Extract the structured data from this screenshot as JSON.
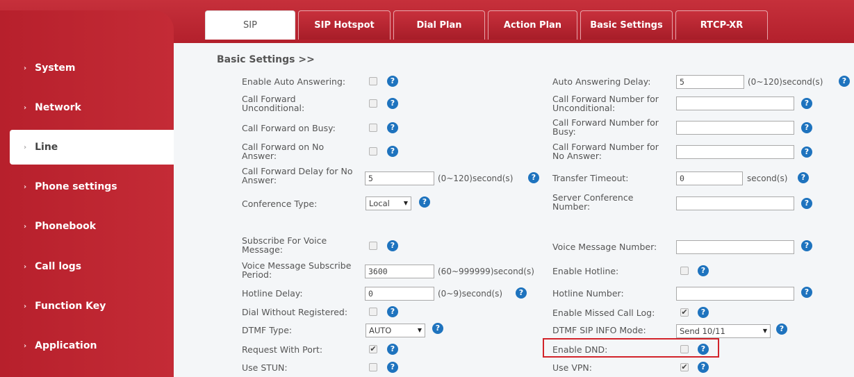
{
  "tabs": [
    {
      "label": "SIP",
      "active": true
    },
    {
      "label": "SIP Hotspot",
      "active": false
    },
    {
      "label": "Dial Plan",
      "active": false
    },
    {
      "label": "Action Plan",
      "active": false
    },
    {
      "label": "Basic Settings",
      "active": false
    },
    {
      "label": "RTCP-XR",
      "active": false
    }
  ],
  "sidebar": {
    "items": [
      {
        "label": "System"
      },
      {
        "label": "Network"
      },
      {
        "label": "Line",
        "active": true
      },
      {
        "label": "Phone settings"
      },
      {
        "label": "Phonebook"
      },
      {
        "label": "Call logs"
      },
      {
        "label": "Function Key"
      },
      {
        "label": "Application"
      }
    ]
  },
  "section_title": "Basic Settings >>",
  "help_glyph": "?",
  "check_glyph": "✔",
  "left_fields": {
    "enable_auto_answering": {
      "label": "Enable Auto Answering:",
      "checked": false
    },
    "cf_unconditional": {
      "label": "Call Forward Unconditional:",
      "checked": false
    },
    "cf_busy": {
      "label": "Call Forward on Busy:",
      "checked": false
    },
    "cf_no_answer": {
      "label": "Call Forward on No Answer:",
      "checked": false
    },
    "cf_delay": {
      "label": "Call Forward Delay for No Answer:",
      "value": "5",
      "unit": "(0~120)second(s)"
    },
    "conference_type": {
      "label": "Conference Type:",
      "value": "Local"
    },
    "subscribe_voice": {
      "label": "Subscribe For Voice Message:",
      "checked": false
    },
    "vm_subscribe_period": {
      "label": "Voice Message Subscribe Period:",
      "value": "3600",
      "unit": "(60~999999)second(s)"
    },
    "hotline_delay": {
      "label": "Hotline Delay:",
      "value": "0",
      "unit": "(0~9)second(s)"
    },
    "dial_without_registered": {
      "label": "Dial Without Registered:",
      "checked": false
    },
    "dtmf_type": {
      "label": "DTMF Type:",
      "value": "AUTO"
    },
    "request_with_port": {
      "label": "Request With Port:",
      "checked": true
    },
    "use_stun": {
      "label": "Use STUN:",
      "checked": false
    }
  },
  "right_fields": {
    "auto_answering_delay": {
      "label": "Auto Answering Delay:",
      "value": "5",
      "unit": "(0~120)second(s)"
    },
    "cf_number_unconditional": {
      "label": "Call Forward Number for Unconditional:",
      "value": ""
    },
    "cf_number_busy": {
      "label": "Call Forward Number for Busy:",
      "value": ""
    },
    "cf_number_no_answer": {
      "label": "Call Forward Number for No Answer:",
      "value": ""
    },
    "transfer_timeout": {
      "label": "Transfer Timeout:",
      "value": "0",
      "unit": "second(s)"
    },
    "server_conference_number": {
      "label": "Server Conference Number:",
      "value": ""
    },
    "voice_message_number": {
      "label": "Voice Message Number:",
      "value": ""
    },
    "enable_hotline": {
      "label": "Enable Hotline:",
      "checked": false
    },
    "hotline_number": {
      "label": "Hotline Number:",
      "value": ""
    },
    "enable_missed_call_log": {
      "label": "Enable Missed Call Log:",
      "checked": true
    },
    "dtmf_sip_info_mode": {
      "label": "DTMF SIP INFO Mode:",
      "value": "Send 10/11"
    },
    "enable_dnd": {
      "label": "Enable DND:",
      "checked": false
    },
    "use_vpn": {
      "label": "Use VPN:",
      "checked": true
    }
  },
  "colors": {
    "brand_red": "#c42b36",
    "help_blue": "#1e73be",
    "highlight_red": "#d2232a"
  }
}
